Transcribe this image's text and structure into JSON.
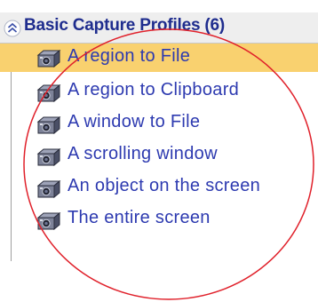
{
  "panel": {
    "header": {
      "title": "Basic Capture Profiles (6)",
      "toggle_icon": "double-chevron-up-icon"
    },
    "items": [
      {
        "label": "A region to File",
        "icon": "camera-icon",
        "selected": true
      },
      {
        "label": "A region to Clipboard",
        "icon": "camera-icon",
        "selected": false
      },
      {
        "label": "A window to File",
        "icon": "camera-icon",
        "selected": false
      },
      {
        "label": "A scrolling window",
        "icon": "camera-icon",
        "selected": false
      },
      {
        "label": "An object on the screen",
        "icon": "camera-icon",
        "selected": false
      },
      {
        "label": "The entire screen",
        "icon": "camera-icon",
        "selected": false
      }
    ]
  },
  "colors": {
    "header_bg": "#eeeeee",
    "header_text": "#1f2d8e",
    "item_text": "#2d3ab0",
    "selected_bg": "#f9d16f",
    "annotation": "#e0202a"
  }
}
